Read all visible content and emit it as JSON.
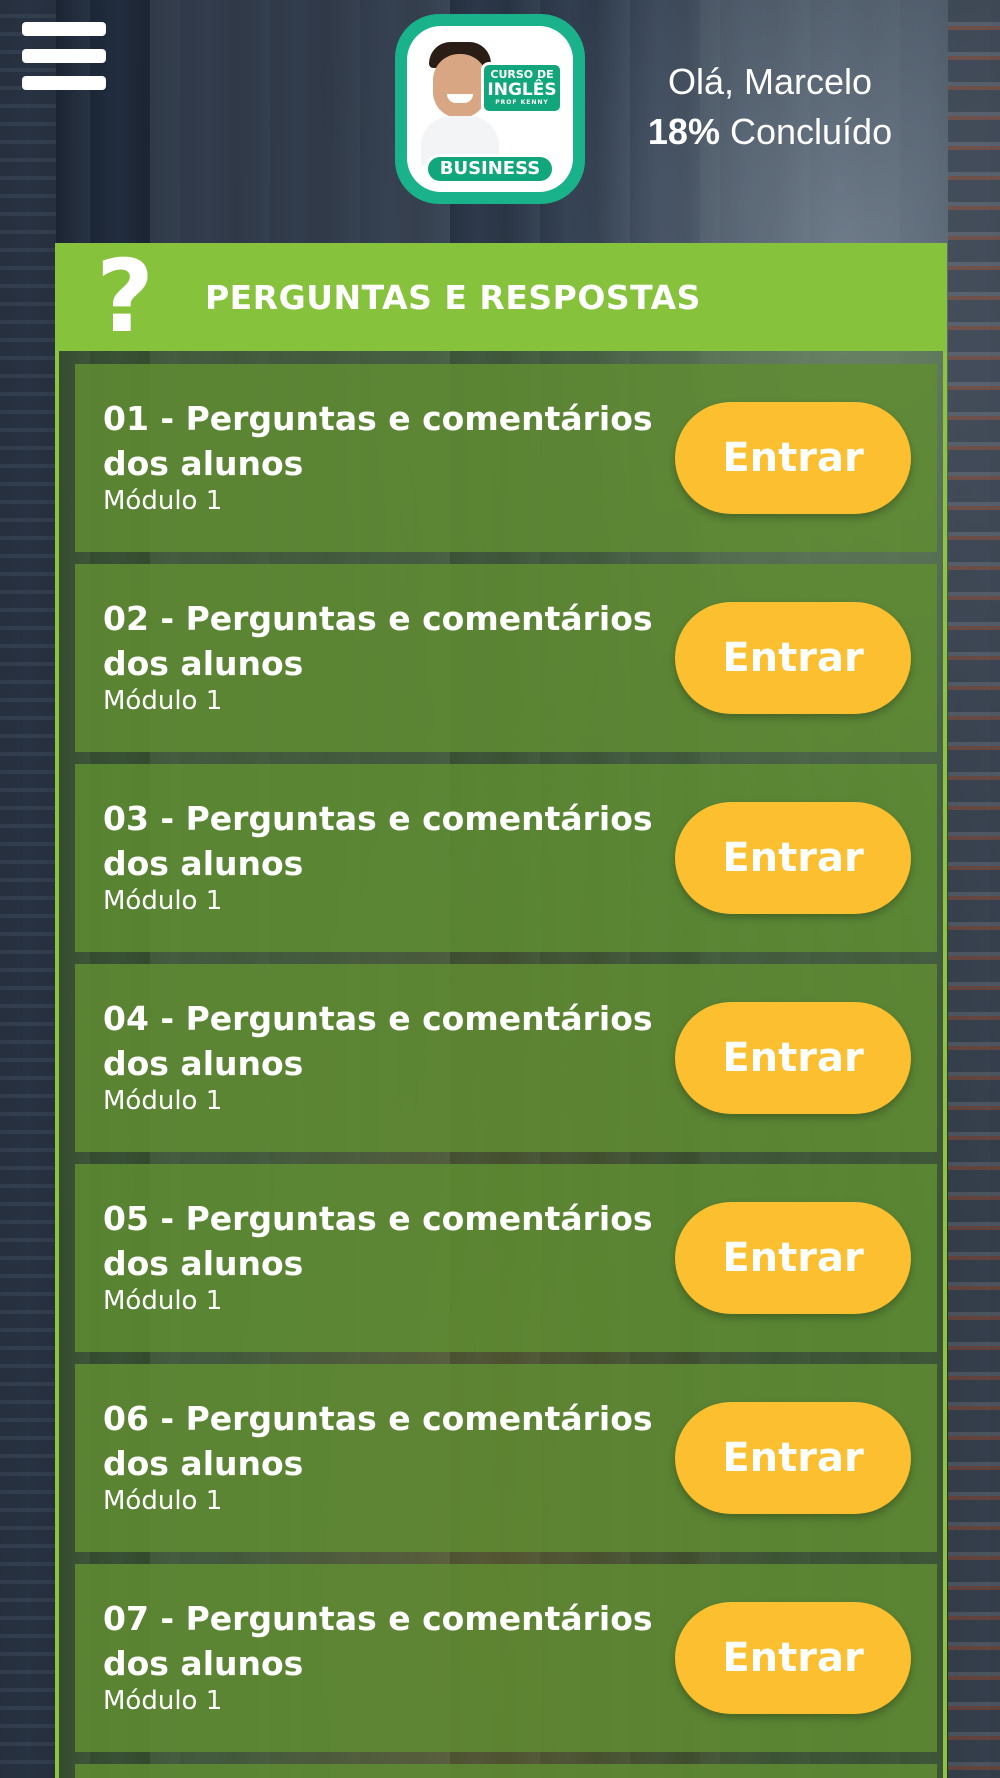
{
  "header": {
    "menu_icon": "hamburger-menu-icon",
    "logo": {
      "badge_line1": "CURSO DE",
      "badge_line2": "INGLÊS",
      "badge_line3": "PROF KENNY",
      "business": "BUSINESS"
    },
    "greeting": "Olá, Marcelo",
    "progress_value": "18%",
    "progress_label": "Concluído"
  },
  "section": {
    "icon": "question-mark-icon",
    "title": "PERGUNTAS E RESPOSTAS"
  },
  "items": [
    {
      "title": "01 - Perguntas e comentários dos alunos",
      "module": "Módulo 1",
      "button": "Entrar"
    },
    {
      "title": "02 - Perguntas e comentários dos alunos",
      "module": "Módulo 1",
      "button": "Entrar"
    },
    {
      "title": "03 - Perguntas e comentários dos alunos",
      "module": "Módulo 1",
      "button": "Entrar"
    },
    {
      "title": "04 - Perguntas e comentários dos alunos",
      "module": "Módulo 1",
      "button": "Entrar"
    },
    {
      "title": "05 - Perguntas e comentários dos alunos",
      "module": "Módulo 1",
      "button": "Entrar"
    },
    {
      "title": "06 - Perguntas e comentários dos alunos",
      "module": "Módulo 1",
      "button": "Entrar"
    },
    {
      "title": "07 - Perguntas e comentários dos alunos",
      "module": "Módulo 1",
      "button": "Entrar"
    }
  ],
  "colors": {
    "accent_green": "#86c23c",
    "item_green": "#608c32",
    "button_yellow": "#fbbf2f",
    "logo_teal": "#19b28a"
  }
}
